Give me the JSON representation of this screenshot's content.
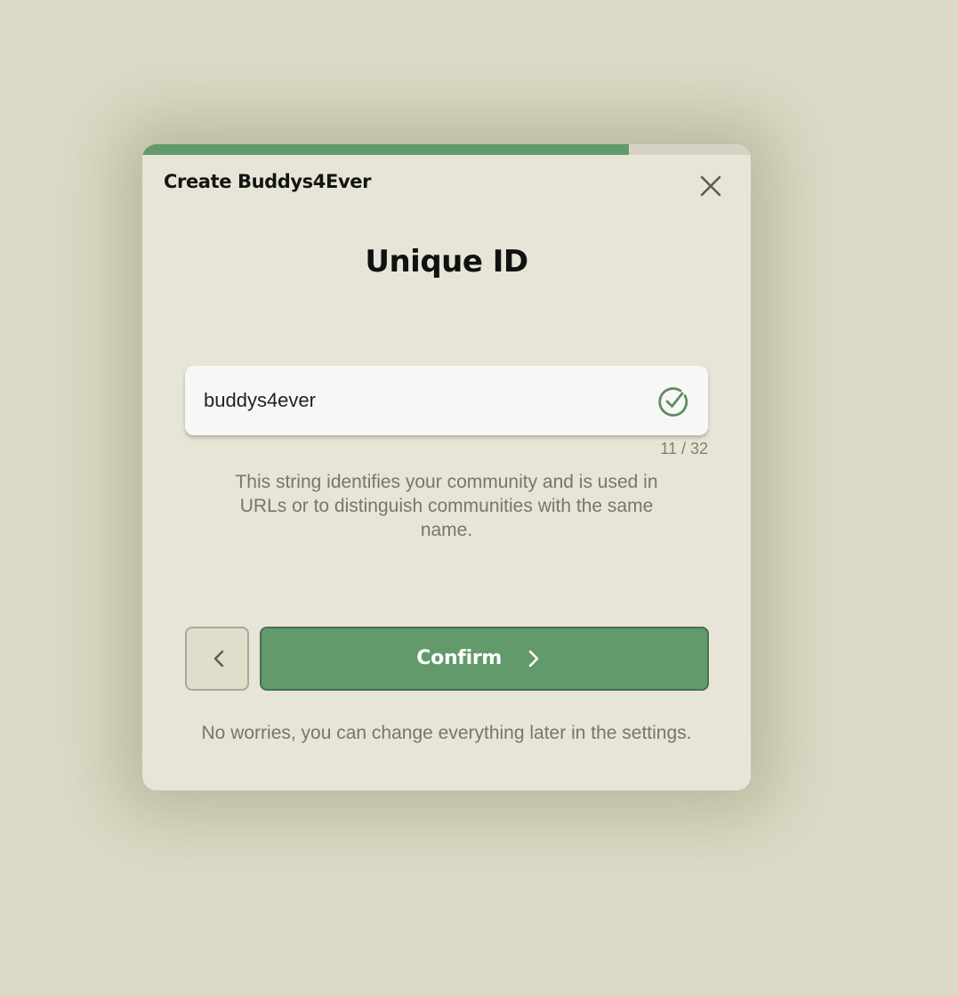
{
  "progress": {
    "fraction": 0.8
  },
  "dialog": {
    "title": "Create Buddys4Ever",
    "close_icon": "close-icon"
  },
  "step": {
    "heading": "Unique ID"
  },
  "id_input": {
    "value": "buddys4ever",
    "valid_icon": "check-circle-icon",
    "counter": "11 / 32"
  },
  "help_text": "This string identifies your community and is used in URLs or to distinguish communities with the same name.",
  "actions": {
    "back_icon": "chevron-left-icon",
    "confirm_label": "Confirm",
    "confirm_icon": "chevron-right-icon"
  },
  "footer_note": "No worries, you can change everything later in the settings.",
  "colors": {
    "accent": "#629a6b",
    "accent_border": "#47714f",
    "background": "#dcdac6",
    "dialog": "#e7e5d7"
  }
}
